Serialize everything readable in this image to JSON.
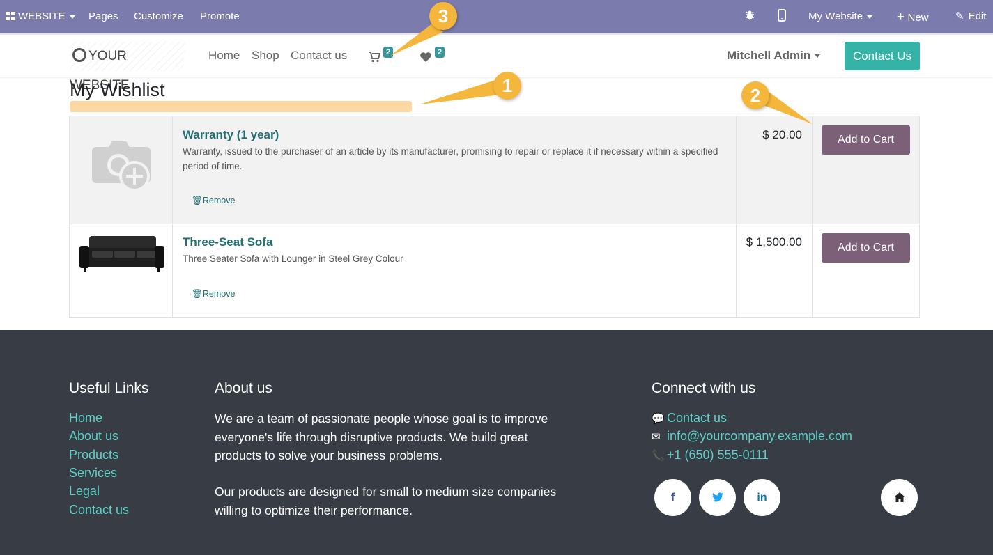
{
  "adminbar": {
    "website_label": "WEBSITE",
    "pages": "Pages",
    "customize": "Customize",
    "promote": "Promote",
    "my_website": "My Website",
    "new": "New",
    "edit": "Edit"
  },
  "header": {
    "logo_text": "YOUR WEBSITE",
    "nav": [
      "Home",
      "Shop",
      "Contact us"
    ],
    "cart_count": "2",
    "wishlist_count": "2",
    "user": "Mitchell Admin",
    "contact_button": "Contact Us"
  },
  "page": {
    "title": "My Wishlist"
  },
  "wishlist": {
    "items": [
      {
        "name": "Warranty (1 year)",
        "description": "Warranty, issued to the purchaser of an article by its manufacturer, promising to repair or replace it if necessary within a specified period of time.",
        "price": "$ 20.00",
        "remove_label": "Remove",
        "add_label": "Add to Cart"
      },
      {
        "name": "Three-Seat Sofa",
        "description": "Three Seater Sofa with Lounger in Steel Grey Colour",
        "price": "$ 1,500.00",
        "remove_label": "Remove",
        "add_label": "Add to Cart"
      }
    ]
  },
  "footer": {
    "useful_links_title": "Useful Links",
    "useful_links": [
      "Home",
      "About us",
      "Products",
      "Services",
      "Legal",
      "Contact us"
    ],
    "about_title": "About us",
    "about_p1": "We are a team of passionate people whose goal is to improve everyone's life through disruptive products. We build great products to solve your business problems.",
    "about_p2": "Our products are designed for small to medium size companies willing to optimize their performance.",
    "connect_title": "Connect with us",
    "contact_us": "Contact us",
    "email": "info@yourcompany.example.com",
    "phone": "+1 (650) 555-0111",
    "social": [
      "f",
      "t",
      "in"
    ]
  },
  "callouts": [
    "1",
    "2",
    "3"
  ],
  "colors": {
    "adminbar": "#7c7bad",
    "accent": "#35b3a7",
    "add_to_cart": "#7b6077",
    "footer": "#373c45",
    "footer_link": "#5ed0c6",
    "callout": "#f4b63b"
  }
}
